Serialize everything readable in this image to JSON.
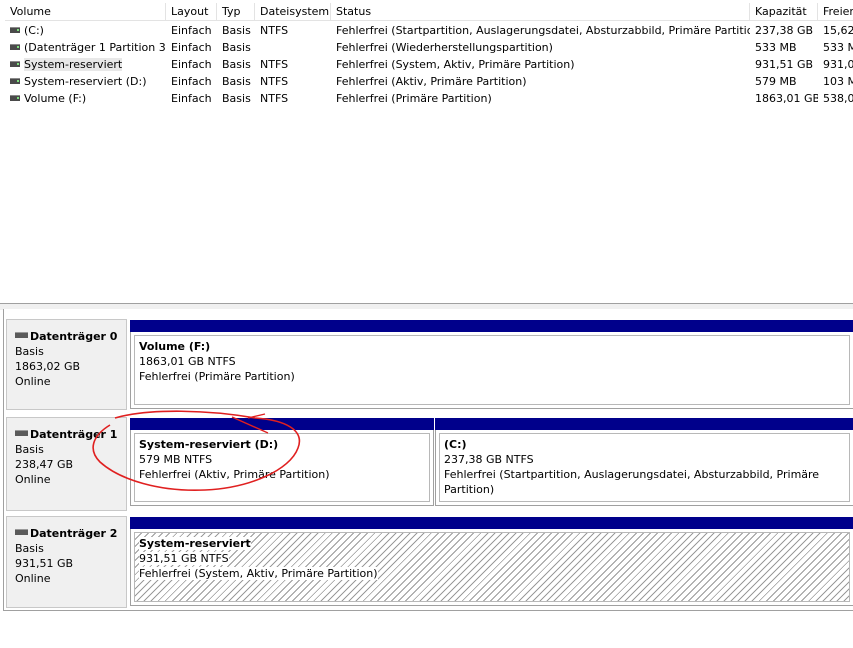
{
  "volume_list": {
    "columns": [
      {
        "label": "Volume"
      },
      {
        "label": "Layout"
      },
      {
        "label": "Typ"
      },
      {
        "label": "Dateisystem"
      },
      {
        "label": "Status"
      },
      {
        "label": "Kapazität"
      },
      {
        "label": "Freier"
      }
    ],
    "rows": [
      {
        "volume": "(C:)",
        "layout": "Einfach",
        "typ": "Basis",
        "fs": "NTFS",
        "status": "Fehlerfrei (Startpartition, Auslagerungsdatei, Absturzabbild, Primäre Partition)",
        "capacity": "237,38 GB",
        "free": "15,62"
      },
      {
        "volume": "(Datenträger 1 Partition 3)",
        "layout": "Einfach",
        "typ": "Basis",
        "fs": "",
        "status": "Fehlerfrei (Wiederherstellungspartition)",
        "capacity": "533 MB",
        "free": "533 M"
      },
      {
        "volume": "System-reserviert",
        "layout": "Einfach",
        "typ": "Basis",
        "fs": "NTFS",
        "status": "Fehlerfrei (System, Aktiv, Primäre Partition)",
        "capacity": "931,51 GB",
        "free": "931,0"
      },
      {
        "volume": "System-reserviert (D:)",
        "layout": "Einfach",
        "typ": "Basis",
        "fs": "NTFS",
        "status": "Fehlerfrei (Aktiv, Primäre Partition)",
        "capacity": "579 MB",
        "free": "103 M"
      },
      {
        "volume": "Volume (F:)",
        "layout": "Einfach",
        "typ": "Basis",
        "fs": "NTFS",
        "status": "Fehlerfrei (Primäre Partition)",
        "capacity": "1863,01 GB",
        "free": "538,0"
      }
    ],
    "selected_row": 2
  },
  "disks": [
    {
      "name": "Datenträger 0",
      "type": "Basis",
      "size": "1863,02 GB",
      "state": "Online",
      "partitions": [
        {
          "title": "Volume  (F:)",
          "size_fs": "1863,01 GB NTFS",
          "status": "Fehlerfrei (Primäre Partition)",
          "hatched": false
        }
      ]
    },
    {
      "name": "Datenträger 1",
      "type": "Basis",
      "size": "238,47 GB",
      "state": "Online",
      "partitions": [
        {
          "title": "System-reserviert  (D:)",
          "size_fs": "579 MB NTFS",
          "status": "Fehlerfrei (Aktiv, Primäre Partition)",
          "hatched": false
        },
        {
          "title": "(C:)",
          "size_fs": "237,38 GB NTFS",
          "status": "Fehlerfrei (Startpartition, Auslagerungsdatei, Absturzabbild, Primäre Partition)",
          "hatched": false
        }
      ]
    },
    {
      "name": "Datenträger 2",
      "type": "Basis",
      "size": "931,51 GB",
      "state": "Online",
      "partitions": [
        {
          "title": "System-reserviert",
          "size_fs": "931,51 GB NTFS",
          "status": "Fehlerfrei (System, Aktiv, Primäre Partition)",
          "hatched": true
        }
      ]
    }
  ],
  "colors": {
    "partition_bar": "#00008b",
    "annotation": "#e02020"
  },
  "icons": {
    "volume": "drive-icon",
    "disk": "disk-icon"
  }
}
